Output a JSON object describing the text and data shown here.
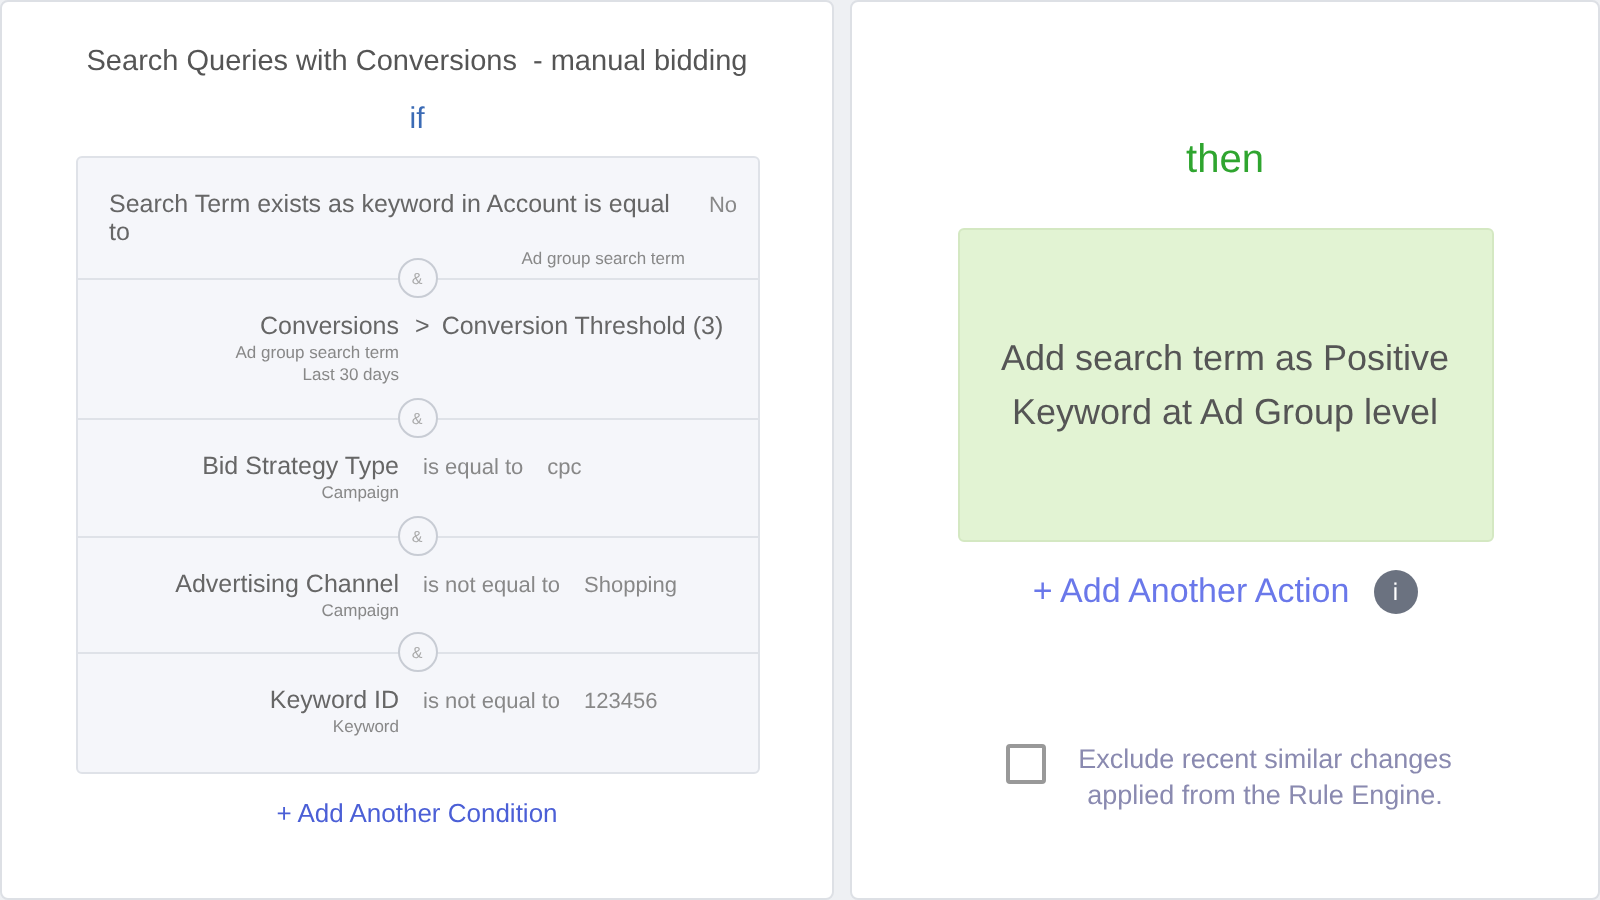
{
  "left_panel": {
    "title": "Search Queries with Conversions  - manual bidding",
    "if_label": "if",
    "conditions": [
      {
        "field": "Search Term exists as keyword in Account is equal to",
        "scopes": [
          "Ad group search term"
        ],
        "value": "No"
      },
      {
        "field": "Conversions",
        "scopes": [
          "Ad group search term",
          "Last 30 days"
        ],
        "operator": ">",
        "value": "Conversion Threshold (3)"
      },
      {
        "field": "Bid Strategy Type",
        "scopes": [
          "Campaign"
        ],
        "operator": "is equal to",
        "value": "cpc"
      },
      {
        "field": "Advertising Channel",
        "scopes": [
          "Campaign"
        ],
        "operator": "is not equal to",
        "value": "Shopping"
      },
      {
        "field": "Keyword ID",
        "scopes": [
          "Keyword"
        ],
        "operator": "is not equal to",
        "value": "123456"
      }
    ],
    "joiner": "&",
    "add_condition": "+ Add Another Condition"
  },
  "right_panel": {
    "then_label": "then",
    "action": "Add search term as Positive Keyword at Ad Group level",
    "add_action": "+ Add Another Action",
    "info": "i",
    "exclude_checkbox": {
      "label": "Exclude recent similar changes applied from the Rule Engine.",
      "checked": false
    }
  }
}
